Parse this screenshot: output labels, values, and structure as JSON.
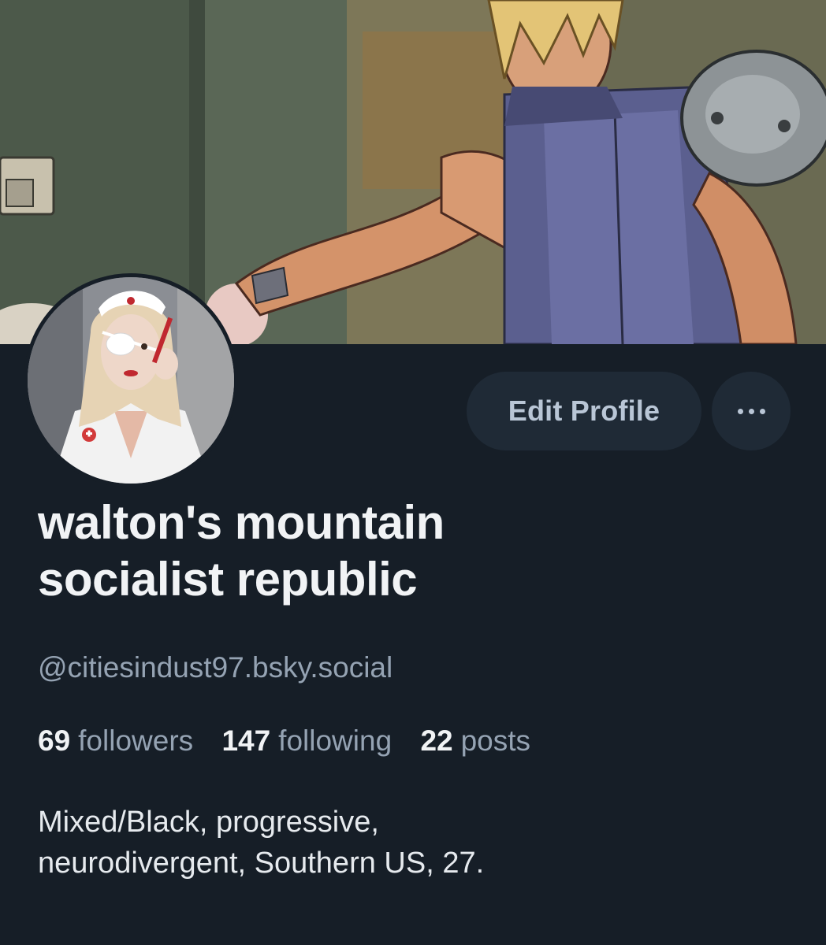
{
  "profile": {
    "display_name_line1": "walton's mountain",
    "display_name_line2": "socialist republic",
    "handle": "@citiesindust97.bsky.social",
    "stats": {
      "followers_count": "69",
      "followers_label": "followers",
      "following_count": "147",
      "following_label": "following",
      "posts_count": "22",
      "posts_label": "posts"
    },
    "bio_line1": "Mixed/Black, progressive,",
    "bio_line2": "neurodivergent, Southern US, 27."
  },
  "actions": {
    "edit_profile_label": "Edit Profile",
    "more_icon": "ellipsis-horizontal-icon"
  },
  "colors": {
    "background": "#161e27",
    "button_bg": "#1f2a36",
    "button_text": "#b9c6d6",
    "primary_text": "#f1f3f5",
    "secondary_text": "#95a3b3"
  }
}
